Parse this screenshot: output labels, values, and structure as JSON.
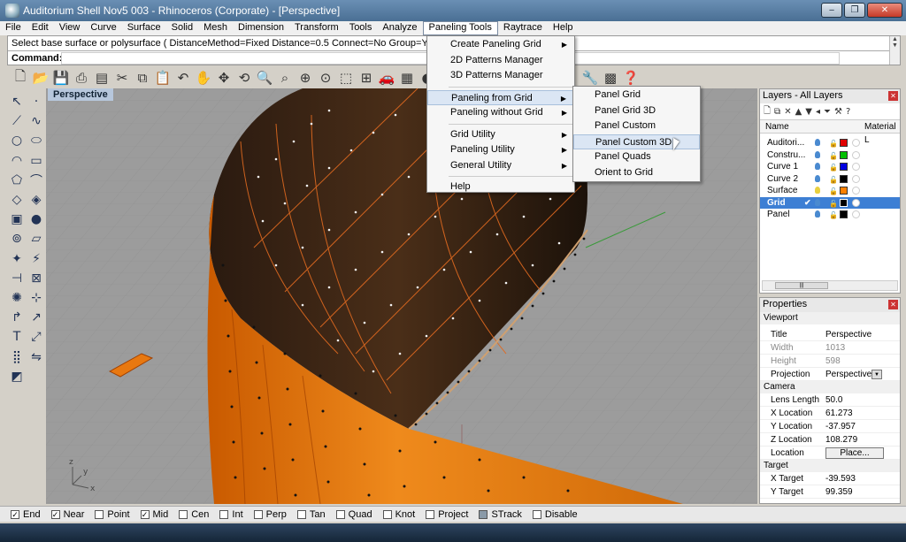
{
  "window": {
    "title": "Auditorium Shell Nov5 003 - Rhinoceros (Corporate) - [Perspective]"
  },
  "menubar": [
    "File",
    "Edit",
    "View",
    "Curve",
    "Surface",
    "Solid",
    "Mesh",
    "Dimension",
    "Transform",
    "Tools",
    "Analyze",
    "Paneling Tools",
    "Raytrace",
    "Help"
  ],
  "command": {
    "prompt_line": "Select base surface or polysurface ( DistanceMethod=Fixed  Distance=0.5  Connect=No  Group=Yes ):",
    "label": "Command:",
    "value": ""
  },
  "viewport": {
    "title": "Perspective"
  },
  "paneling_menu": {
    "items": [
      {
        "label": "Create Paneling Grid",
        "sub": true
      },
      {
        "label": "2D Patterns Manager",
        "sub": false
      },
      {
        "label": "3D Patterns Manager",
        "sub": false
      },
      {
        "label": "Paneling from Grid",
        "sub": true
      },
      {
        "label": "Paneling without Grid",
        "sub": true
      },
      {
        "label": "Grid Utility",
        "sub": true
      },
      {
        "label": "Paneling Utility",
        "sub": true
      },
      {
        "label": "General Utility",
        "sub": true
      },
      {
        "label": "Help",
        "sub": false
      }
    ]
  },
  "submenu": {
    "items": [
      "Panel Grid",
      "Panel Grid 3D",
      "Panel Custom",
      "Panel Custom 3D",
      "Panel Quads",
      "Orient to Grid"
    ]
  },
  "layers": {
    "title": "Layers - All Layers",
    "col_name": "Name",
    "col_material": "Material L",
    "rows": [
      {
        "name": "Auditori...",
        "color": "#e00000"
      },
      {
        "name": "Constru...",
        "color": "#00c000"
      },
      {
        "name": "Curve 1",
        "color": "#0000e0"
      },
      {
        "name": "Curve 2",
        "color": "#000000"
      },
      {
        "name": "Surface",
        "color": "#ff8000"
      },
      {
        "name": "Grid",
        "color": "#000000"
      },
      {
        "name": "Panel",
        "color": "#000000"
      }
    ]
  },
  "properties": {
    "title": "Properties",
    "section_viewport": "Viewport",
    "title_label": "Title",
    "title_value": "Perspective",
    "width_label": "Width",
    "width_value": "1013",
    "height_label": "Height",
    "height_value": "598",
    "projection_label": "Projection",
    "projection_value": "Perspective",
    "section_camera": "Camera",
    "lens_label": "Lens Length",
    "lens_value": "50.0",
    "xloc_label": "X Location",
    "xloc_value": "61.273",
    "yloc_label": "Y Location",
    "yloc_value": "-37.957",
    "zloc_label": "Z Location",
    "zloc_value": "108.279",
    "location_label": "Location",
    "place_button": "Place...",
    "section_target": "Target",
    "xtarget_label": "X Target",
    "xtarget_value": "-39.593",
    "ytarget_label": "Y Target",
    "ytarget_value": "99.359"
  },
  "statusbar": {
    "osnaps": [
      {
        "label": "End",
        "checked": true
      },
      {
        "label": "Near",
        "checked": true
      },
      {
        "label": "Point",
        "checked": false
      },
      {
        "label": "Mid",
        "checked": true
      },
      {
        "label": "Cen",
        "checked": false
      },
      {
        "label": "Int",
        "checked": false
      },
      {
        "label": "Perp",
        "checked": false
      },
      {
        "label": "Tan",
        "checked": false
      },
      {
        "label": "Quad",
        "checked": false
      },
      {
        "label": "Knot",
        "checked": false
      },
      {
        "label": "Project",
        "checked": false
      },
      {
        "label": "STrack",
        "checked": true
      },
      {
        "label": "Disable",
        "checked": false
      }
    ]
  }
}
